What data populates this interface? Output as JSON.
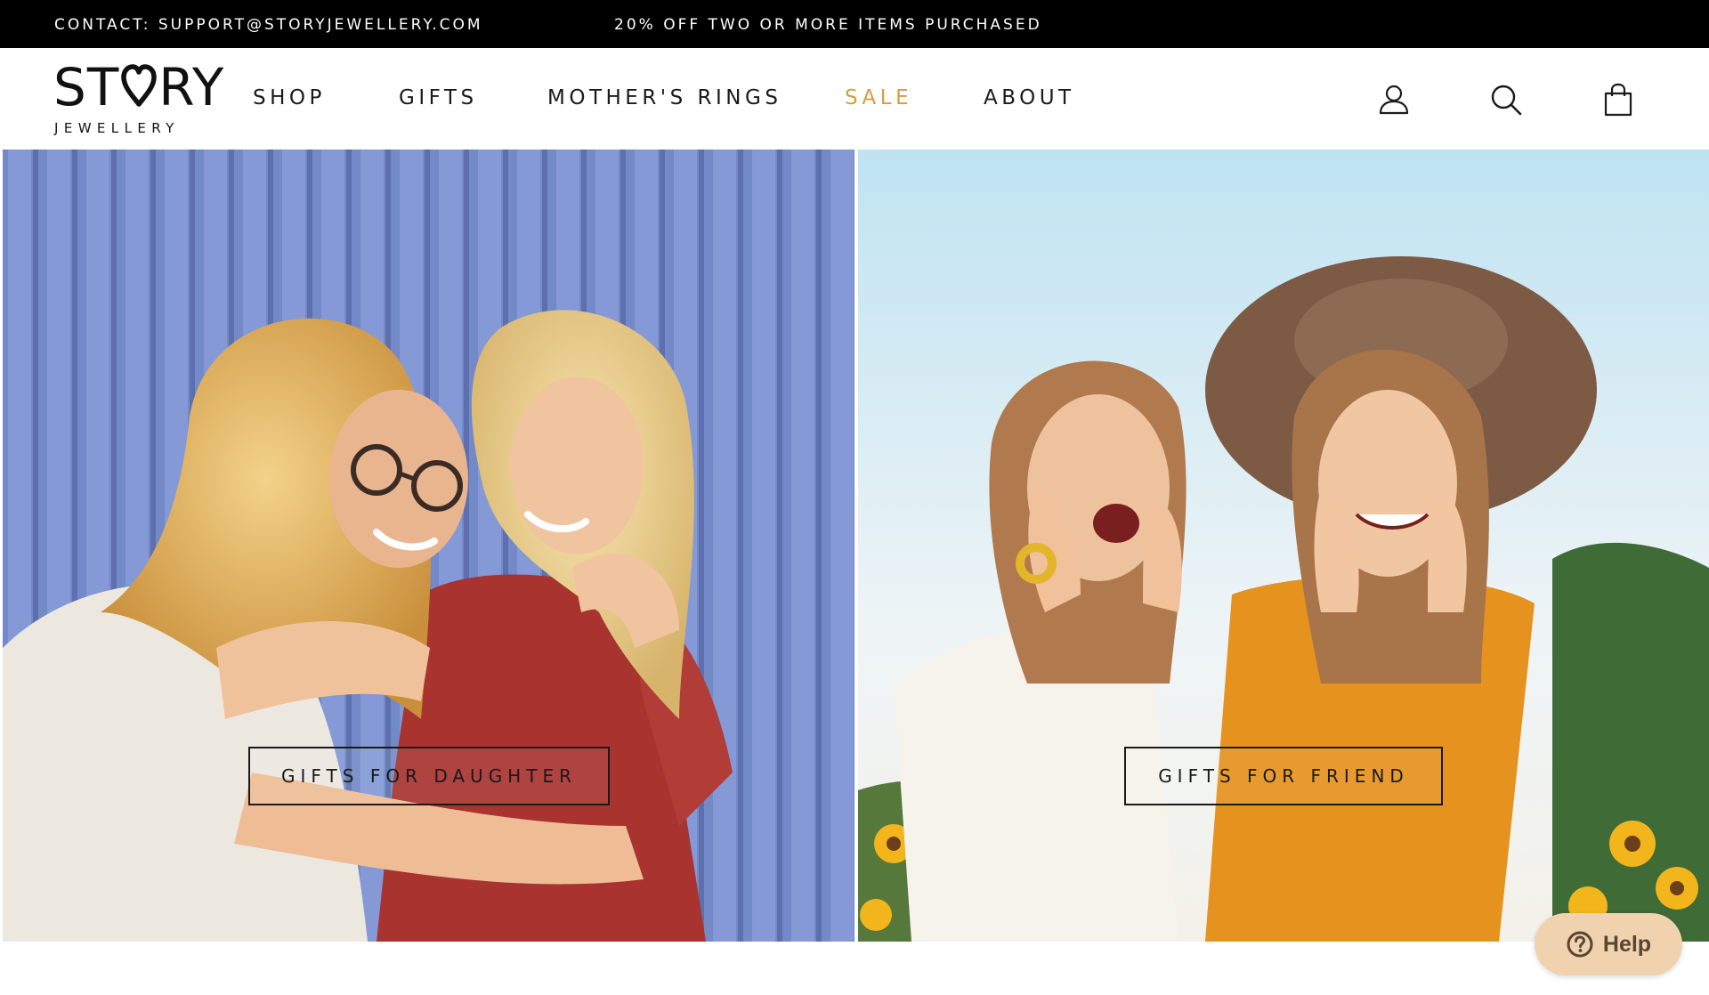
{
  "announcement": {
    "contact": "CONTACT: SUPPORT@STORYJEWELLERY.COM",
    "promo": "20% OFF TWO OR MORE ITEMS PURCHASED"
  },
  "brand": {
    "name_before": "ST",
    "name_after": "RY",
    "subtitle": "JEWELLERY"
  },
  "nav": {
    "items": [
      {
        "label": "SHOP"
      },
      {
        "label": "GIFTS"
      },
      {
        "label": "MOTHER'S RINGS"
      },
      {
        "label": "SALE"
      },
      {
        "label": "ABOUT"
      }
    ]
  },
  "header_icons": [
    "account-icon",
    "search-icon",
    "cart-icon"
  ],
  "hero": {
    "left_cta": "GIFTS FOR DAUGHTER",
    "right_cta": "GIFTS FOR FRIEND"
  },
  "help": {
    "label": "Help"
  },
  "colors": {
    "topbar_bg": "#000000",
    "sale_accent": "#d49d3f",
    "help_bg": "#f0d3ae",
    "help_text": "#5a4632"
  }
}
